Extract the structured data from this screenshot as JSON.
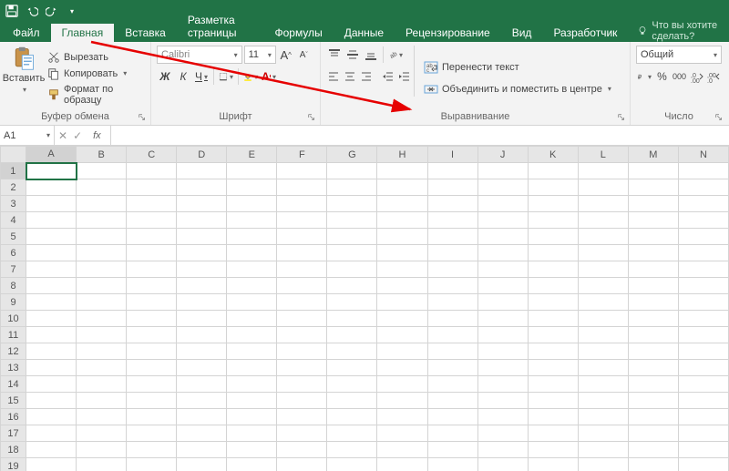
{
  "tabs": {
    "file": "Файл",
    "home": "Главная",
    "insert": "Вставка",
    "layout": "Разметка страницы",
    "formulas": "Формулы",
    "data": "Данные",
    "review": "Рецензирование",
    "view": "Вид",
    "developer": "Разработчик",
    "tellme": "Что вы хотите сделать?"
  },
  "clipboard": {
    "paste": "Вставить",
    "cut": "Вырезать",
    "copy": "Копировать",
    "format_painter": "Формат по образцу",
    "group_label": "Буфер обмена"
  },
  "font": {
    "name": "Calibri",
    "size": "11",
    "group_label": "Шрифт",
    "bold": "Ж",
    "italic": "К",
    "underline": "Ч"
  },
  "alignment": {
    "wrap": "Перенести текст",
    "merge": "Объединить и поместить в центре",
    "group_label": "Выравнивание"
  },
  "number": {
    "format": "Общий",
    "group_label": "Число"
  },
  "formula_bar": {
    "name_box": "A1"
  },
  "grid": {
    "columns": [
      "A",
      "B",
      "C",
      "D",
      "E",
      "F",
      "G",
      "H",
      "I",
      "J",
      "K",
      "L",
      "M",
      "N"
    ],
    "rows": [
      "1",
      "2",
      "3",
      "4",
      "5",
      "6",
      "7",
      "8",
      "9",
      "10",
      "11",
      "12",
      "13",
      "14",
      "15",
      "16",
      "17",
      "18",
      "19"
    ],
    "active_cell": "A1"
  }
}
